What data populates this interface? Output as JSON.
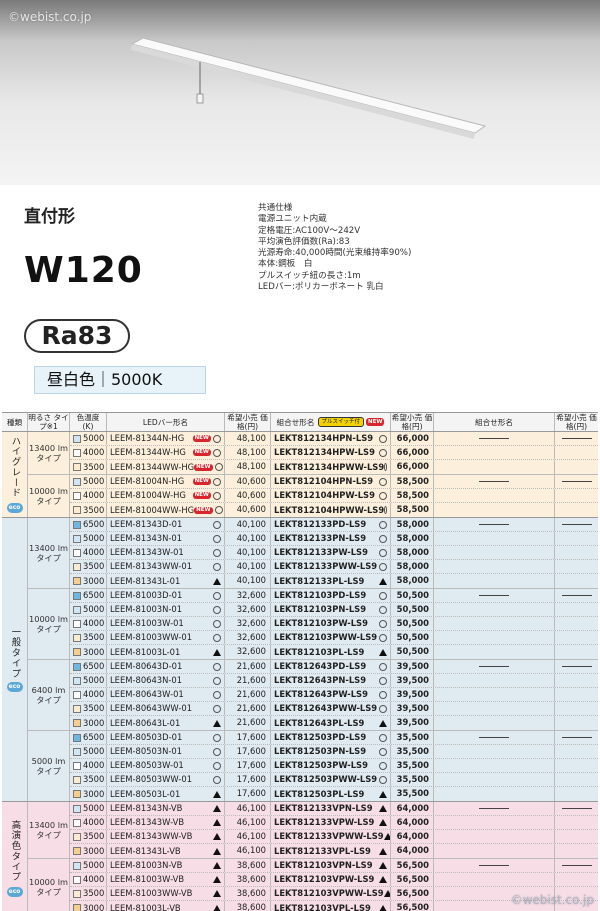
{
  "watermark_top": "©webist.co.jp",
  "watermark_bottom": "©webist.co.jp",
  "title_type": "直付形",
  "title_model": "W120",
  "ra_badge": "Ra83",
  "color_label": "昼白色｜5000K",
  "specs": [
    "共通仕様",
    "電源ユニット内蔵",
    "定格電圧:AC100V～242V",
    "平均演色評価数(Ra):83",
    "光源寿命:40,000時間(光束維持率90%)",
    "本体:鋼板　白",
    "プルスイッチ紐の長さ:1m",
    "LEDバー:ポリカーボネート 乳白"
  ],
  "headers": {
    "kind": "種類",
    "bright": "明るさ タイプ※1",
    "temp": "色温度 (K)",
    "led": "LEDバー形名",
    "price1": "希望小売 価格(円)",
    "comb": "組合せ形名",
    "pull_badge": "プルスイッチ付",
    "new_badge": "NEW",
    "price2": "希望小売 価格(円)",
    "comb2": "組合せ形名",
    "price3": "希望小売 価格(円)"
  },
  "colors": {
    "6500": "#6fb7e3",
    "5000": "#cfe6f4",
    "4000": "#ffffff",
    "3500": "#fbecd0",
    "3000": "#f5cf8c"
  },
  "groups": [
    {
      "kind": "ハイグレード",
      "eco": "eco",
      "style": "g-high",
      "subs": [
        {
          "bright": "13400 lmタイプ",
          "rows": [
            {
              "temp": "5000",
              "led": "LEEM-81344N-HG",
              "new": true,
              "mark": "o",
              "p1": "48,100",
              "comb": "LEKT812134HPN-LS9",
              "cmark": "o",
              "p2": "66,000"
            },
            {
              "temp": "4000",
              "led": "LEEM-81344W-HG",
              "new": true,
              "mark": "o",
              "p1": "48,100",
              "comb": "LEKT812134HPW-LS9",
              "cmark": "o",
              "p2": "66,000"
            },
            {
              "temp": "3500",
              "led": "LEEM-81344WW-HG",
              "new": true,
              "mark": "o",
              "p1": "48,100",
              "comb": "LEKT812134HPWW-LS9",
              "cmark": "o",
              "p2": "66,000"
            }
          ]
        },
        {
          "bright": "10000 lmタイプ",
          "rows": [
            {
              "temp": "5000",
              "led": "LEEM-81004N-HG",
              "new": true,
              "mark": "o",
              "p1": "40,600",
              "comb": "LEKT812104HPN-LS9",
              "cmark": "o",
              "p2": "58,500"
            },
            {
              "temp": "4000",
              "led": "LEEM-81004W-HG",
              "new": true,
              "mark": "o",
              "p1": "40,600",
              "comb": "LEKT812104HPW-LS9",
              "cmark": "o",
              "p2": "58,500"
            },
            {
              "temp": "3500",
              "led": "LEEM-81004WW-HG",
              "new": true,
              "mark": "o",
              "p1": "40,600",
              "comb": "LEKT812104HPWW-LS9",
              "cmark": "o",
              "p2": "58,500"
            }
          ]
        }
      ]
    },
    {
      "kind": "一般タイプ",
      "eco": "eco",
      "style": "g-gen",
      "subs": [
        {
          "bright": "13400 lmタイプ",
          "rows": [
            {
              "temp": "6500",
              "led": "LEEM-81343D-01",
              "new": false,
              "mark": "o",
              "p1": "40,100",
              "comb": "LEKT812133PD-LS9",
              "cmark": "o",
              "p2": "58,000"
            },
            {
              "temp": "5000",
              "led": "LEEM-81343N-01",
              "new": false,
              "mark": "o",
              "p1": "40,100",
              "comb": "LEKT812133PN-LS9",
              "cmark": "o",
              "p2": "58,000"
            },
            {
              "temp": "4000",
              "led": "LEEM-81343W-01",
              "new": false,
              "mark": "o",
              "p1": "40,100",
              "comb": "LEKT812133PW-LS9",
              "cmark": "o",
              "p2": "58,000"
            },
            {
              "temp": "3500",
              "led": "LEEM-81343WW-01",
              "new": false,
              "mark": "o",
              "p1": "40,100",
              "comb": "LEKT812133PWW-LS9",
              "cmark": "o",
              "p2": "58,000"
            },
            {
              "temp": "3000",
              "led": "LEEM-81343L-01",
              "new": false,
              "mark": "t",
              "p1": "40,100",
              "comb": "LEKT812133PL-LS9",
              "cmark": "t",
              "p2": "58,000"
            }
          ]
        },
        {
          "bright": "10000 lmタイプ",
          "rows": [
            {
              "temp": "6500",
              "led": "LEEM-81003D-01",
              "new": false,
              "mark": "o",
              "p1": "32,600",
              "comb": "LEKT812103PD-LS9",
              "cmark": "o",
              "p2": "50,500"
            },
            {
              "temp": "5000",
              "led": "LEEM-81003N-01",
              "new": false,
              "mark": "o",
              "p1": "32,600",
              "comb": "LEKT812103PN-LS9",
              "cmark": "o",
              "p2": "50,500"
            },
            {
              "temp": "4000",
              "led": "LEEM-81003W-01",
              "new": false,
              "mark": "o",
              "p1": "32,600",
              "comb": "LEKT812103PW-LS9",
              "cmark": "o",
              "p2": "50,500"
            },
            {
              "temp": "3500",
              "led": "LEEM-81003WW-01",
              "new": false,
              "mark": "o",
              "p1": "32,600",
              "comb": "LEKT812103PWW-LS9",
              "cmark": "o",
              "p2": "50,500"
            },
            {
              "temp": "3000",
              "led": "LEEM-81003L-01",
              "new": false,
              "mark": "t",
              "p1": "32,600",
              "comb": "LEKT812103PL-LS9",
              "cmark": "t",
              "p2": "50,500"
            }
          ]
        },
        {
          "bright": "6400 lmタイプ",
          "rows": [
            {
              "temp": "6500",
              "led": "LEEM-80643D-01",
              "new": false,
              "mark": "o",
              "p1": "21,600",
              "comb": "LEKT812643PD-LS9",
              "cmark": "o",
              "p2": "39,500"
            },
            {
              "temp": "5000",
              "led": "LEEM-80643N-01",
              "new": false,
              "mark": "o",
              "p1": "21,600",
              "comb": "LEKT812643PN-LS9",
              "cmark": "o",
              "p2": "39,500"
            },
            {
              "temp": "4000",
              "led": "LEEM-80643W-01",
              "new": false,
              "mark": "o",
              "p1": "21,600",
              "comb": "LEKT812643PW-LS9",
              "cmark": "o",
              "p2": "39,500"
            },
            {
              "temp": "3500",
              "led": "LEEM-80643WW-01",
              "new": false,
              "mark": "o",
              "p1": "21,600",
              "comb": "LEKT812643PWW-LS9",
              "cmark": "o",
              "p2": "39,500"
            },
            {
              "temp": "3000",
              "led": "LEEM-80643L-01",
              "new": false,
              "mark": "t",
              "p1": "21,600",
              "comb": "LEKT812643PL-LS9",
              "cmark": "t",
              "p2": "39,500"
            }
          ]
        },
        {
          "bright": "5000 lmタイプ",
          "rows": [
            {
              "temp": "6500",
              "led": "LEEM-80503D-01",
              "new": false,
              "mark": "o",
              "p1": "17,600",
              "comb": "LEKT812503PD-LS9",
              "cmark": "o",
              "p2": "35,500"
            },
            {
              "temp": "5000",
              "led": "LEEM-80503N-01",
              "new": false,
              "mark": "o",
              "p1": "17,600",
              "comb": "LEKT812503PN-LS9",
              "cmark": "o",
              "p2": "35,500"
            },
            {
              "temp": "4000",
              "led": "LEEM-80503W-01",
              "new": false,
              "mark": "o",
              "p1": "17,600",
              "comb": "LEKT812503PW-LS9",
              "cmark": "o",
              "p2": "35,500"
            },
            {
              "temp": "3500",
              "led": "LEEM-80503WW-01",
              "new": false,
              "mark": "o",
              "p1": "17,600",
              "comb": "LEKT812503PWW-LS9",
              "cmark": "o",
              "p2": "35,500"
            },
            {
              "temp": "3000",
              "led": "LEEM-80503L-01",
              "new": false,
              "mark": "t",
              "p1": "17,600",
              "comb": "LEKT812503PL-LS9",
              "cmark": "t",
              "p2": "35,500"
            }
          ]
        }
      ]
    },
    {
      "kind": "高演色タイプ",
      "eco": "eco",
      "style": "g-hc",
      "subs": [
        {
          "bright": "13400 lmタイプ",
          "rows": [
            {
              "temp": "5000",
              "led": "LEEM-81343N-VB",
              "new": false,
              "mark": "t",
              "p1": "46,100",
              "comb": "LEKT812133VPN-LS9",
              "cmark": "t",
              "p2": "64,000"
            },
            {
              "temp": "4000",
              "led": "LEEM-81343W-VB",
              "new": false,
              "mark": "t",
              "p1": "46,100",
              "comb": "LEKT812133VPW-LS9",
              "cmark": "t",
              "p2": "64,000"
            },
            {
              "temp": "3500",
              "led": "LEEM-81343WW-VB",
              "new": false,
              "mark": "t",
              "p1": "46,100",
              "comb": "LEKT812133VPWW-LS9",
              "cmark": "t",
              "p2": "64,000"
            },
            {
              "temp": "3000",
              "led": "LEEM-81343L-VB",
              "new": false,
              "mark": "t",
              "p1": "46,100",
              "comb": "LEKT812133VPL-LS9",
              "cmark": "t",
              "p2": "64,000"
            }
          ]
        },
        {
          "bright": "10000 lmタイプ",
          "rows": [
            {
              "temp": "5000",
              "led": "LEEM-81003N-VB",
              "new": false,
              "mark": "t",
              "p1": "38,600",
              "comb": "LEKT812103VPN-LS9",
              "cmark": "t",
              "p2": "56,500"
            },
            {
              "temp": "4000",
              "led": "LEEM-81003W-VB",
              "new": false,
              "mark": "t",
              "p1": "38,600",
              "comb": "LEKT812103VPW-LS9",
              "cmark": "t",
              "p2": "56,500"
            },
            {
              "temp": "3500",
              "led": "LEEM-81003WW-VB",
              "new": false,
              "mark": "t",
              "p1": "38,600",
              "comb": "LEKT812103VPWW-LS9",
              "cmark": "t",
              "p2": "56,500"
            },
            {
              "temp": "3000",
              "led": "LEEM-81003L-VB",
              "new": false,
              "mark": "t",
              "p1": "38,600",
              "comb": "LEKT812103VPL-LS9",
              "cmark": "t",
              "p2": "56,500"
            }
          ]
        }
      ]
    }
  ]
}
